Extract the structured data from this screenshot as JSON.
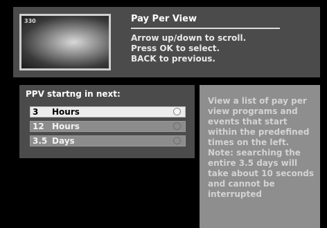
{
  "header": {
    "thumbnail_channel": "330",
    "title": "Pay Per View",
    "instructions": [
      "Arrow up/down to scroll.",
      "Press OK to select.",
      "BACK to previous."
    ]
  },
  "ppv": {
    "label": "PPV startng in next:",
    "options": [
      {
        "num": "3",
        "unit": "Hours",
        "selected": true
      },
      {
        "num": "12",
        "unit": "Hours",
        "selected": false
      },
      {
        "num": "3.5",
        "unit": "Days",
        "selected": false
      }
    ]
  },
  "help": {
    "text": "View a list of pay per view programs and events that start within the predefined times on the left. Note: searching the entire 3.5 days will take about 10 seconds and cannot be interrupted"
  },
  "colors": {
    "background": "#000000",
    "panel": "#4b4b4b",
    "help_panel": "#8e8e8e",
    "selected_row": "#ececec",
    "unselected_row": "#8c8c8c"
  }
}
